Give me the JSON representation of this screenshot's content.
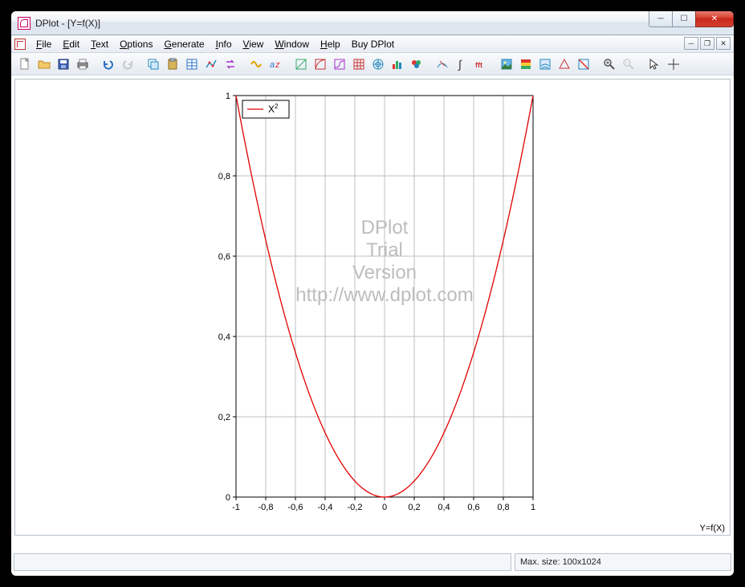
{
  "window": {
    "title": "DPlot - [Y=f(X)]"
  },
  "menus": {
    "items": [
      "File",
      "Edit",
      "Text",
      "Options",
      "Generate",
      "Info",
      "View",
      "Window",
      "Help",
      "Buy DPlot"
    ]
  },
  "status": {
    "main": "",
    "size": "Max. size: 100x1024",
    "corner": "Y=f(X)"
  },
  "watermark": {
    "line1": "DPlot",
    "line2": "Trial",
    "line3": "Version",
    "line4": "http://www.dplot.com"
  },
  "legend": {
    "series1": "X",
    "series1_sup": "2"
  },
  "chart_data": {
    "type": "line",
    "title": "",
    "xlabel": "",
    "ylabel": "",
    "xlim": [
      -1,
      1
    ],
    "ylim": [
      0,
      1
    ],
    "x_ticks": [
      -1,
      -0.8,
      -0.6,
      -0.4,
      -0.2,
      0,
      0.2,
      0.4,
      0.6,
      0.8,
      1
    ],
    "x_tick_labels": [
      "-1",
      "-0,8",
      "-0,6",
      "-0,4",
      "-0,2",
      "0",
      "0,2",
      "0,4",
      "0,6",
      "0,8",
      "1"
    ],
    "y_ticks": [
      0,
      0.2,
      0.4,
      0.6,
      0.8,
      1
    ],
    "y_tick_labels": [
      "0",
      "0,2",
      "0,4",
      "0,6",
      "0,8",
      "1"
    ],
    "grid": true,
    "series": [
      {
        "name": "X²",
        "color": "#e10000",
        "x": [
          -1,
          -0.9,
          -0.8,
          -0.7,
          -0.6,
          -0.5,
          -0.4,
          -0.3,
          -0.2,
          -0.1,
          0,
          0.1,
          0.2,
          0.3,
          0.4,
          0.5,
          0.6,
          0.7,
          0.8,
          0.9,
          1
        ],
        "y": [
          1,
          0.81,
          0.64,
          0.49,
          0.36,
          0.25,
          0.16,
          0.09,
          0.04,
          0.01,
          0,
          0.01,
          0.04,
          0.09,
          0.16,
          0.25,
          0.36,
          0.49,
          0.64,
          0.81,
          1
        ]
      }
    ]
  }
}
